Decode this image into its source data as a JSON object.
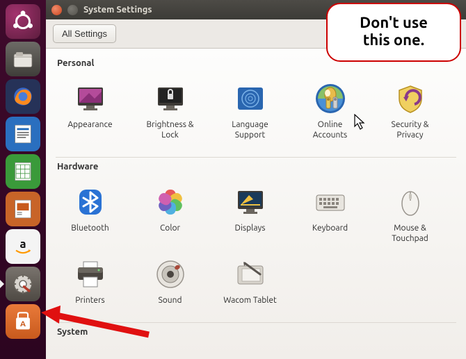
{
  "window": {
    "title": "System Settings"
  },
  "toolbar": {
    "all_settings": "All Settings"
  },
  "sections": {
    "personal": {
      "title": "Personal",
      "items": [
        "Appearance",
        "Brightness &\nLock",
        "Language\nSupport",
        "Online\nAccounts",
        "Security &\nPrivacy"
      ]
    },
    "hardware": {
      "title": "Hardware",
      "items": [
        "Bluetooth",
        "Color",
        "Displays",
        "Keyboard",
        "Mouse &\nTouchpad",
        "Printers",
        "Sound",
        "Wacom Tablet"
      ]
    },
    "system": {
      "title": "System"
    }
  },
  "annotation": {
    "callout_text": "Don't use\nthis one."
  },
  "launcher": {
    "items": [
      "ubuntu-dash",
      "files",
      "firefox",
      "libreoffice-writer",
      "libreoffice-calc",
      "libreoffice-impress",
      "amazon",
      "system-settings",
      "ubuntu-software"
    ]
  }
}
